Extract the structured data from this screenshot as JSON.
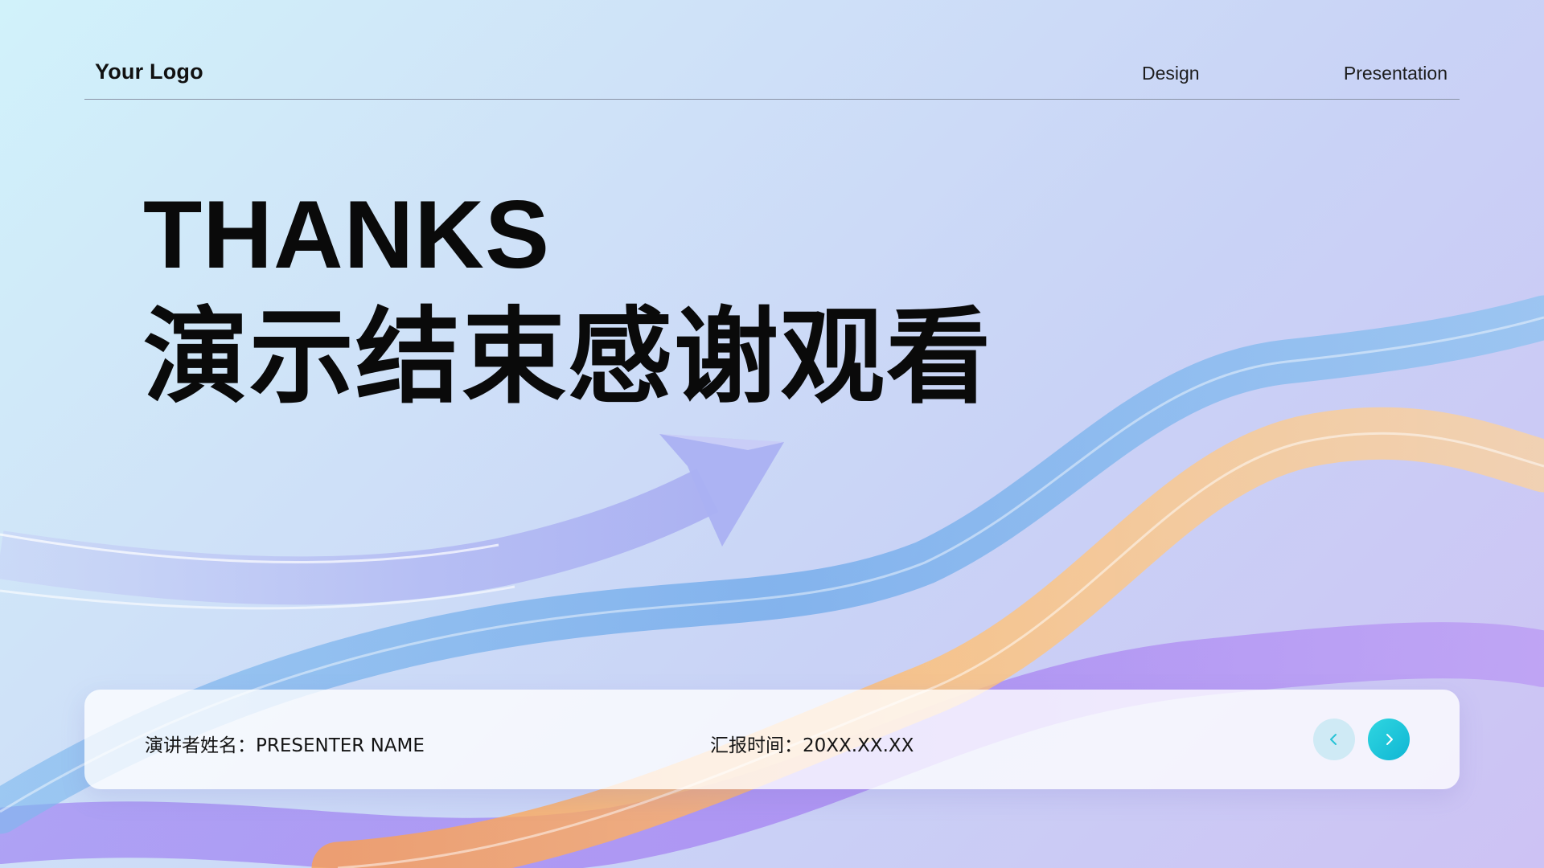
{
  "header": {
    "logo": "Your Logo",
    "nav": [
      {
        "label": "Design"
      },
      {
        "label": "Presentation"
      }
    ]
  },
  "hero": {
    "title_en": "THANKS",
    "title_cn": "演示结束感谢观看"
  },
  "footer": {
    "presenter": "演讲者姓名：PRESENTER NAME",
    "report_time": "汇报时间：20XX.XX.XX"
  },
  "icons": {
    "prev": "chevron-left-icon",
    "next": "chevron-right-icon"
  },
  "colors": {
    "accent": "#1ec3d9",
    "accent_light": "#cfeaf5",
    "text": "#0a0a0a"
  }
}
